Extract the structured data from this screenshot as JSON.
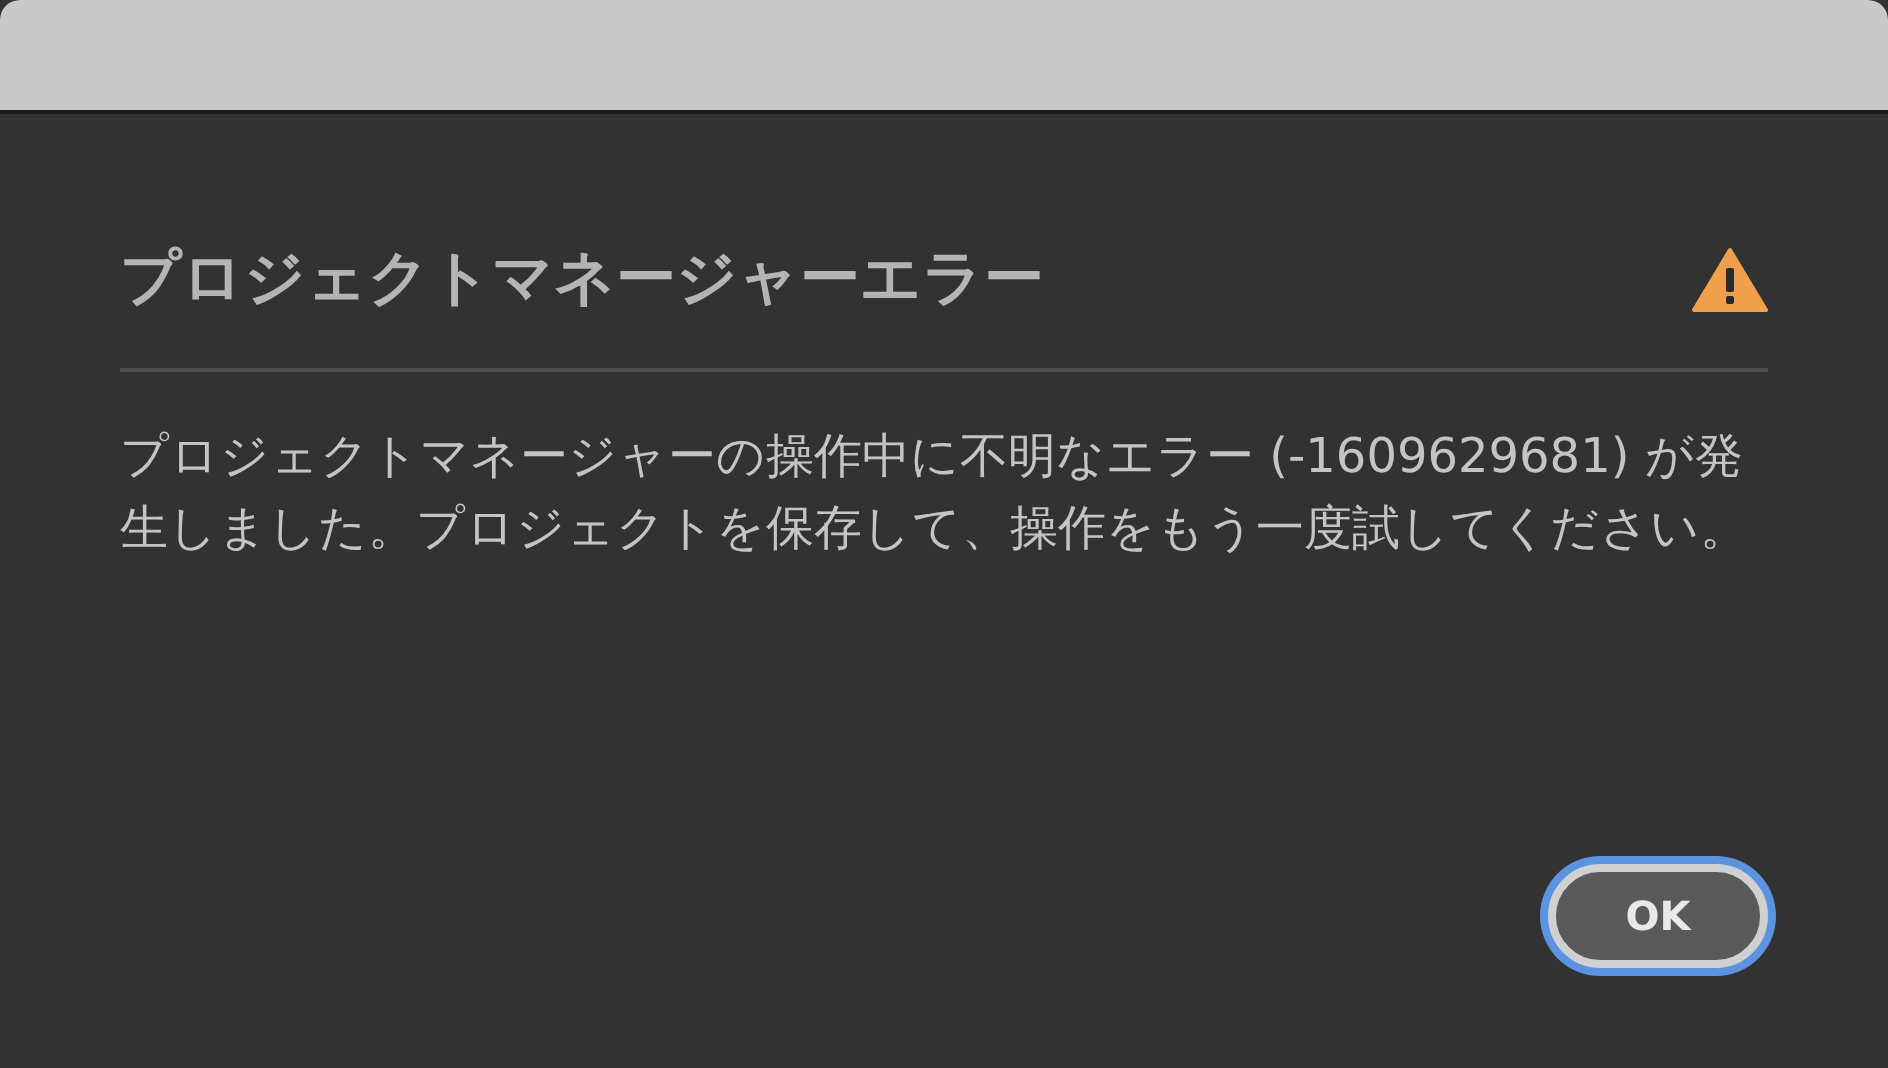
{
  "dialog": {
    "title": "プロジェクトマネージャーエラー",
    "message": "プロジェクトマネージャーの操作中に不明なエラー (-1609629681) が発生しました。プロジェクトを保存して、操作をもう一度試してください。"
  },
  "buttons": [
    {
      "label": "OK",
      "focused": true
    }
  ]
}
